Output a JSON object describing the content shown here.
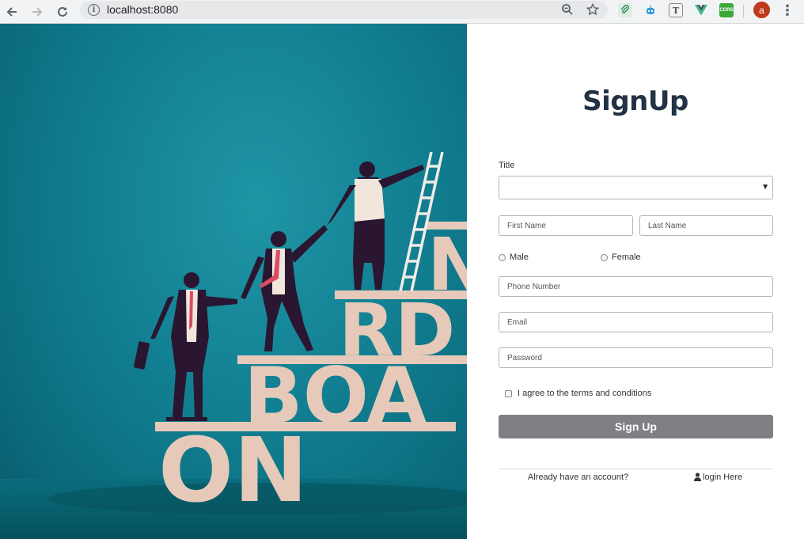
{
  "browser": {
    "url": "localhost:8080",
    "back_icon": "arrow-left-icon",
    "forward_icon": "arrow-right-icon",
    "reload_icon": "reload-icon",
    "zoom_icon": "zoom-out-icon",
    "bookmark_icon": "star-icon",
    "extensions": [
      "paperclip-icon",
      "robot-icon",
      "text-icon",
      "vue-icon",
      "cors-icon"
    ],
    "extension_cors_label": "CORS",
    "profile_initial": "a",
    "profile_color": "#c0391c",
    "menu_icon": "kebab-icon"
  },
  "hero": {
    "letters_row1": "ON",
    "letters_row2": "BOA",
    "letters_row3": "RD",
    "letters_top": "N",
    "background_color": "#117f91"
  },
  "form": {
    "heading": "SignUp",
    "title_label": "Title",
    "title_value": "",
    "first_name_placeholder": "First Name",
    "last_name_placeholder": "Last Name",
    "gender_male": "Male",
    "gender_female": "Female",
    "phone_placeholder": "Phone Number",
    "email_placeholder": "Email",
    "password_placeholder": "Password",
    "terms_label": "I agree to the terms and conditions",
    "submit_label": "Sign Up",
    "submit_color": "#7e8085",
    "account_prompt": "Already have an account?",
    "login_link": "login Here"
  }
}
